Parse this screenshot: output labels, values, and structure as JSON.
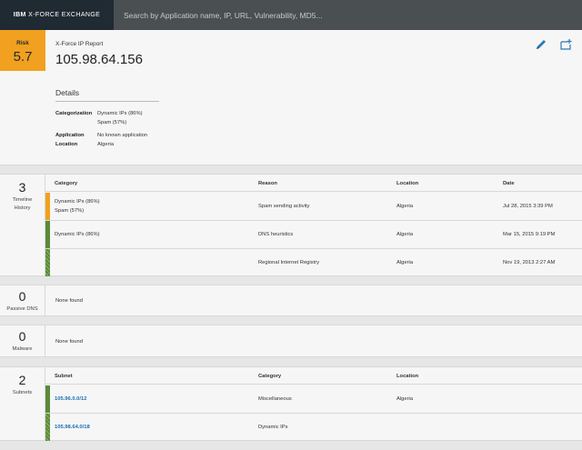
{
  "header": {
    "brand_bold": "IBM",
    "brand_rest": "X-FORCE EXCHANGE",
    "search_placeholder": "Search by Application name, IP, URL, Vulnerability, MD5..."
  },
  "report": {
    "risk_label": "Risk",
    "risk_value": "5.7",
    "title": "X-Force IP Report",
    "ip": "105.98.64.156",
    "details_heading": "Details",
    "categorization_key": "Categorization",
    "categorization_values": [
      "Dynamic IPs (86%)",
      "Spam (57%)"
    ],
    "application_key": "Application",
    "application_value": "No known application",
    "location_key": "Location",
    "location_value": "Algeria"
  },
  "timeline": {
    "count": "3",
    "label_line1": "Timeline",
    "label_line2": "History",
    "columns": [
      "Category",
      "Reason",
      "Location",
      "Date"
    ],
    "rows": [
      {
        "category": [
          "Dynamic IPs (86%)",
          "Spam (57%)"
        ],
        "reason": "Spam sending activity",
        "location": "Algeria",
        "date": "Jul 28, 2015 3:39 PM"
      },
      {
        "category": [
          "Dynamic IPs (86%)"
        ],
        "reason": "DNS heuristics",
        "location": "Algeria",
        "date": "Mar 15, 2015 9:19 PM"
      },
      {
        "category": [],
        "reason": "Regional Internet Registry",
        "location": "Algeria",
        "date": "Nov 19, 2013 2:27 AM"
      }
    ]
  },
  "passive_dns": {
    "count": "0",
    "label": "Passive DNS",
    "empty": "None found"
  },
  "malware": {
    "count": "0",
    "label": "Malware",
    "empty": "None found"
  },
  "subnets": {
    "count": "2",
    "label": "Subnets",
    "columns": [
      "Subnet",
      "Category",
      "Location"
    ],
    "rows": [
      {
        "subnet": "105.96.0.0/12",
        "category": "Miscellaneous",
        "location": "Algeria"
      },
      {
        "subnet": "105.98.64.0/18",
        "category": "Dynamic IPs",
        "location": ""
      }
    ]
  },
  "colors": {
    "risk": "#f1a01f",
    "brand_bg": "#1f2a33",
    "topbar": "#4a4f52",
    "link": "#1a6fb3",
    "bar_green": "#5a8a3a"
  }
}
